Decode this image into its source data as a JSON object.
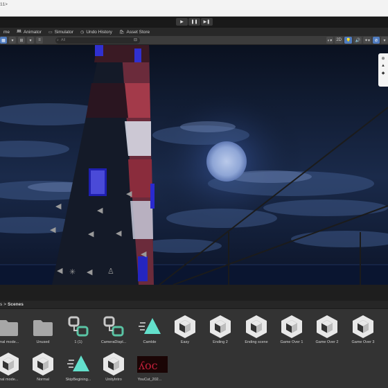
{
  "window": {
    "title": "11>"
  },
  "toolbar": {
    "play": "▶",
    "pause": "❚❚",
    "step": "▶❚"
  },
  "tabs": [
    {
      "label": "me",
      "icon": ""
    },
    {
      "label": "Animator",
      "icon": "animator-icon"
    },
    {
      "label": "Simulator",
      "icon": "simulator-icon"
    },
    {
      "label": "Undo History",
      "icon": "history-icon"
    },
    {
      "label": "Asset Store",
      "icon": "store-icon"
    }
  ],
  "scene_toolbar": {
    "search_placeholder": "All",
    "mode_2d": "2D"
  },
  "project": {
    "breadcrumb_parent": "s",
    "breadcrumb_sep": ">",
    "breadcrumb_current": "Scenes"
  },
  "assets": [
    {
      "label": "rmal mode...",
      "type": "folder"
    },
    {
      "label": "Unused",
      "type": "folder"
    },
    {
      "label": "1 (1)",
      "type": "animator"
    },
    {
      "label": "CameraDispl...",
      "type": "animator"
    },
    {
      "label": "Camlde",
      "type": "anim"
    },
    {
      "label": "Easy",
      "type": "scene"
    },
    {
      "label": "Ending 2",
      "type": "scene"
    },
    {
      "label": "Ending scene",
      "type": "scene"
    },
    {
      "label": "Game Over 1",
      "type": "scene"
    },
    {
      "label": "Game Over 2",
      "type": "scene"
    },
    {
      "label": "Game Over 3",
      "type": "scene"
    },
    {
      "label": "mal mode...",
      "type": "scene"
    },
    {
      "label": "Normal",
      "type": "scene"
    },
    {
      "label": "SkipBegining...",
      "type": "anim"
    },
    {
      "label": "UnityIntro",
      "type": "scene"
    },
    {
      "label": "YouCut_202...",
      "type": "video"
    }
  ]
}
